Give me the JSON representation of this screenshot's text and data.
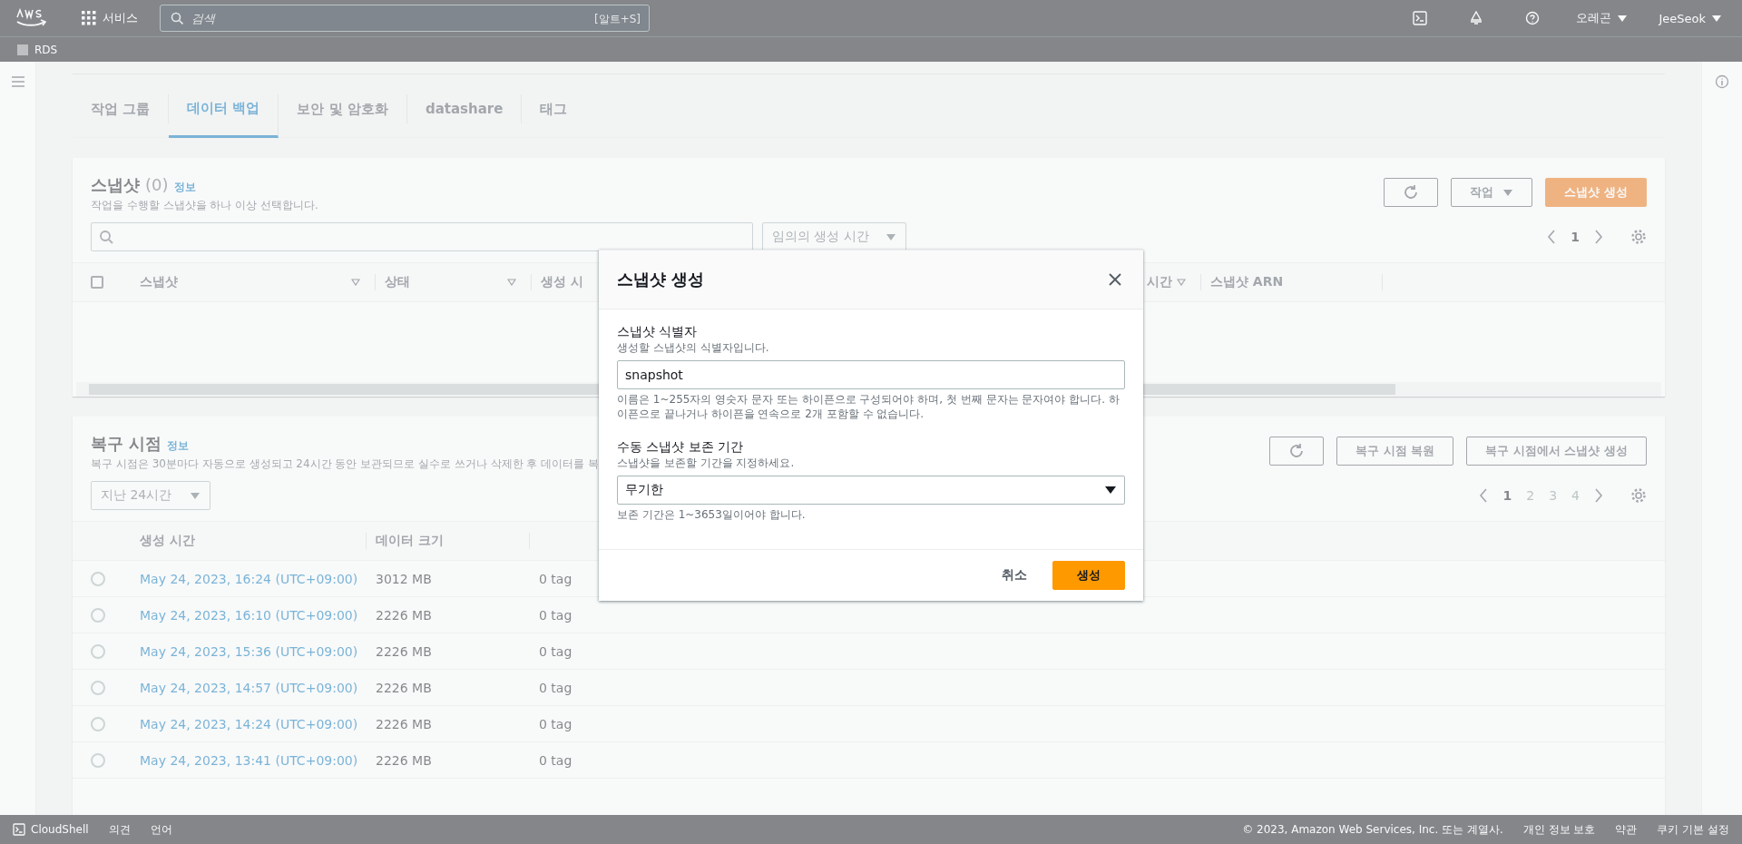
{
  "top_nav": {
    "services": "서비스",
    "search_placeholder": "검색",
    "search_shortcut": "[알트+S]",
    "region": "오레곤",
    "user": "JeeSeok"
  },
  "breadcrumb": "RDS",
  "tabs": [
    {
      "label": "작업 그룹",
      "selected": false
    },
    {
      "label": "데이터 백업",
      "selected": true
    },
    {
      "label": "보안 및 암호화",
      "selected": false
    },
    {
      "label": "datashare",
      "selected": false
    },
    {
      "label": "태그",
      "selected": false
    }
  ],
  "snapshots": {
    "title": "스냅샷",
    "count": "(0)",
    "info": "정보",
    "description": "작업을 수행할 스냅샷을 하나 이상 선택합니다.",
    "actions": "작업",
    "create": "스냅샷 생성",
    "filter": "임의의 생성 시간",
    "page": "1",
    "select_all_checked": false,
    "columns": [
      "스냅샷",
      "상태",
      "생성 시",
      "시간",
      "스냅샷 ARN"
    ]
  },
  "restore_points": {
    "title": "복구 시점",
    "info": "정보",
    "description": "복구 시점은 30분마다 자동으로 생성되고 24시간 동안 보관되므로 실수로 쓰거나 삭제한 후 데이터를 복",
    "restore": "복구 시점 복원",
    "create": "복구 시점에서 스냅샷 생성",
    "range": "지난 24시간",
    "pages": [
      {
        "label": "1",
        "selected": true
      },
      {
        "label": "2",
        "selected": false
      },
      {
        "label": "3",
        "selected": false
      },
      {
        "label": "4",
        "selected": false
      }
    ],
    "columns": [
      "생성 시간",
      "데이터 크기"
    ],
    "rows": [
      {
        "time": "May 24, 2023, 16:24 (UTC+09:00)",
        "size": "3012 MB",
        "tags": "0 tag",
        "selected": false
      },
      {
        "time": "May 24, 2023, 16:10 (UTC+09:00)",
        "size": "2226 MB",
        "tags": "0 tag",
        "selected": false
      },
      {
        "time": "May 24, 2023, 15:36 (UTC+09:00)",
        "size": "2226 MB",
        "tags": "0 tag",
        "selected": false
      },
      {
        "time": "May 24, 2023, 14:57 (UTC+09:00)",
        "size": "2226 MB",
        "tags": "0 tag",
        "selected": false
      },
      {
        "time": "May 24, 2023, 14:24 (UTC+09:00)",
        "size": "2226 MB",
        "tags": "0 tag",
        "selected": false
      },
      {
        "time": "May 24, 2023, 13:41 (UTC+09:00)",
        "size": "2226 MB",
        "tags": "0 tag",
        "selected": false
      }
    ]
  },
  "modal": {
    "title": "스냅샷 생성",
    "identifier": {
      "label": "스냅샷 식별자",
      "description": "생성할 스냅샷의 식별자입니다.",
      "value": "snapshot",
      "constraint": "이름은 1~255자의 영숫자 문자 또는 하이픈으로 구성되어야 하며, 첫 번째 문자는 문자여야 합니다. 하이픈으로 끝나거나 하이픈을 연속으로 2개 포함할 수 없습니다."
    },
    "retention": {
      "label": "수동 스냅샷 보존 기간",
      "description": "스냅샷을 보존할 기간을 지정하세요.",
      "value": "무기한",
      "constraint": "보존 기간은 1~3653일이어야 합니다."
    },
    "cancel": "취소",
    "submit": "생성"
  },
  "footer": {
    "cloudshell": "CloudShell",
    "feedback": "의견",
    "language": "언어",
    "copyright": "© 2023, Amazon Web Services, Inc. 또는 계열사.",
    "links": [
      "개인 정보 보호",
      "약관",
      "쿠키 기본 설정"
    ]
  }
}
